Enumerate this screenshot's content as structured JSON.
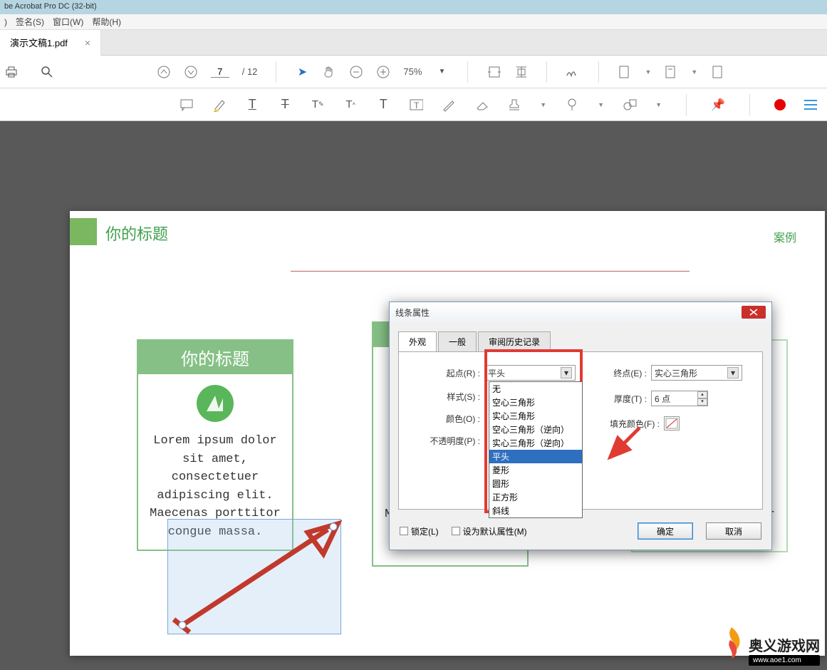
{
  "app": {
    "title": "be Acrobat Pro DC (32-bit)"
  },
  "menu": {
    "items": [
      ")",
      "签名(S)",
      "窗口(W)",
      "帮助(H)"
    ]
  },
  "tab": {
    "label": "演示文稿1.pdf"
  },
  "toolbar": {
    "page_current": "7",
    "page_total": "/ 12",
    "zoom": "75%"
  },
  "doc": {
    "section_title": "你的标题",
    "section_right": "案例",
    "card_title": "你的标题",
    "card_text": "Lorem ipsum dolor sit amet, consectetuer adipiscing elit. Maecenas porttitor congue massa."
  },
  "dialog": {
    "title": "线条属性",
    "tabs": [
      "外观",
      "一般",
      "审阅历史记录"
    ],
    "labels": {
      "start": "起点(R) :",
      "end": "终点(E) :",
      "style": "样式(S) :",
      "thickness": "厚度(T) :",
      "color": "颜色(O) :",
      "fillcolor": "填充颜色(F) :",
      "opacity": "不透明度(P) :"
    },
    "values": {
      "start": "平头",
      "end": "实心三角形",
      "thickness": "6 点"
    },
    "options": [
      "无",
      "空心三角形",
      "实心三角形",
      "空心三角形（逆向）",
      "实心三角形（逆向）",
      "平头",
      "菱形",
      "圆形",
      "正方形",
      "斜线"
    ],
    "lock": "锁定(L)",
    "default": "设为默认属性(M)",
    "ok": "确定",
    "cancel": "取消"
  },
  "watermark": {
    "site": "奥义游戏网",
    "url": "www.aoe1.com"
  }
}
